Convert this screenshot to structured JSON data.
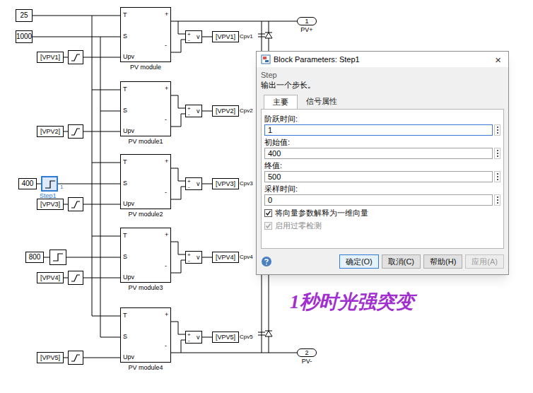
{
  "canvas": {
    "constants": [
      "25",
      "1000",
      "400",
      "800"
    ],
    "from_tags": [
      "[VPV1]",
      "[VPV2]",
      "[VPV3]",
      "[VPV4]",
      "[VPV5]"
    ],
    "modules": [
      {
        "name": "PV module",
        "ports": [
          "T",
          "S",
          "Upv"
        ],
        "outputs": [
          "+",
          "-"
        ]
      },
      {
        "name": "PV module1",
        "ports": [
          "T",
          "S",
          "Upv"
        ],
        "outputs": [
          "+",
          "-"
        ]
      },
      {
        "name": "PV module2",
        "ports": [
          "T",
          "S",
          "Upv"
        ],
        "outputs": [
          "+",
          "-"
        ]
      },
      {
        "name": "PV module3",
        "ports": [
          "T",
          "S",
          "Upv"
        ],
        "outputs": [
          "+",
          "-"
        ]
      },
      {
        "name": "PV module4",
        "ports": [
          "T",
          "S",
          "Upv"
        ],
        "outputs": [
          "+",
          "-"
        ]
      }
    ],
    "step_blocks": [
      {
        "selected": true,
        "label": "Step1",
        "badge": "1"
      },
      {
        "selected": false
      }
    ],
    "sensors": [
      {
        "signs": [
          "+",
          "-"
        ],
        "unit": "v",
        "tag": "[VPV1]",
        "label": "Cpv1"
      },
      {
        "signs": [
          "+",
          "-"
        ],
        "unit": "v",
        "tag": "[VPV2]",
        "label": "Cpv2"
      },
      {
        "signs": [
          "+",
          "-"
        ],
        "unit": "v",
        "tag": "[VPV3]",
        "label": "Cpv3"
      },
      {
        "signs": [
          "+",
          "-"
        ],
        "unit": "v",
        "tag": "[VPV4]",
        "label": "Cpv4"
      },
      {
        "signs": [
          "+",
          "-"
        ],
        "unit": "v",
        "tag": "[VPV5]",
        "label": "Cpv5"
      }
    ],
    "outports": [
      {
        "number": "1",
        "label": "PV+"
      },
      {
        "number": "2",
        "label": "PV-"
      }
    ]
  },
  "annotation": "1秒时光强突变",
  "dialog": {
    "title": "Block Parameters: Step1",
    "close": "×",
    "block_type": "Step",
    "description": "输出一个步长。",
    "tabs": [
      {
        "label": "主要",
        "selected": true
      },
      {
        "label": "信号属性",
        "selected": false
      }
    ],
    "fields": [
      {
        "label": "阶跃时间:",
        "value": "1",
        "focused": true
      },
      {
        "label": "初始值:",
        "value": "400",
        "focused": false
      },
      {
        "label": "终值:",
        "value": "500",
        "focused": false
      },
      {
        "label": "采样时间:",
        "value": "0",
        "focused": false
      }
    ],
    "checkboxes": [
      {
        "label": "将向量参数解释为一维向量",
        "checked": true,
        "disabled": false
      },
      {
        "label": "启用过零检测",
        "checked": true,
        "disabled": true
      }
    ],
    "buttons": [
      {
        "label": "确定(O)",
        "default": true,
        "disabled": false
      },
      {
        "label": "取消(C)",
        "default": false,
        "disabled": false
      },
      {
        "label": "帮助(H)",
        "default": false,
        "disabled": false
      },
      {
        "label": "应用(A)",
        "default": false,
        "disabled": true
      }
    ]
  }
}
